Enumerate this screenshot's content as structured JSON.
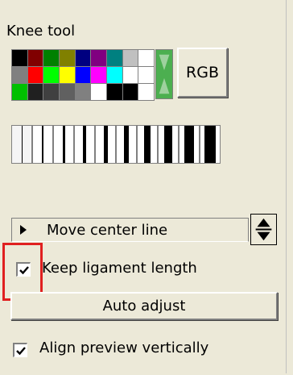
{
  "panel": {
    "title": "Knee tool"
  },
  "palette": {
    "rows": [
      [
        "#000000",
        "#800000",
        "#008000",
        "#808000",
        "#000080",
        "#800080",
        "#008080",
        "#c0c0c0",
        "#ffffff"
      ],
      [
        "#808080",
        "#ff0000",
        "#00ff00",
        "#ffff00",
        "#0000ff",
        "#ff00ff",
        "#00ffff",
        "#ffffff",
        "#ffffff"
      ],
      [
        "#00c000",
        "#202020",
        "#404040",
        "#606060",
        "#808080",
        "#ffffff",
        "#000000",
        "#000000",
        "#ffffff"
      ]
    ],
    "selected_color": "#4caf50"
  },
  "buttons": {
    "rgb_label": "RGB",
    "auto_adjust_label": "Auto adjust"
  },
  "line_widths": [
    1,
    2,
    3,
    4,
    5,
    6,
    8,
    10,
    12,
    14
  ],
  "mode": {
    "value": "Move center line"
  },
  "options": {
    "keep_ligament_length": {
      "label": "Keep ligament length",
      "checked": true
    },
    "align_preview_vertically": {
      "label": "Align preview vertically",
      "checked": true
    }
  },
  "highlight_color": "#e02020"
}
